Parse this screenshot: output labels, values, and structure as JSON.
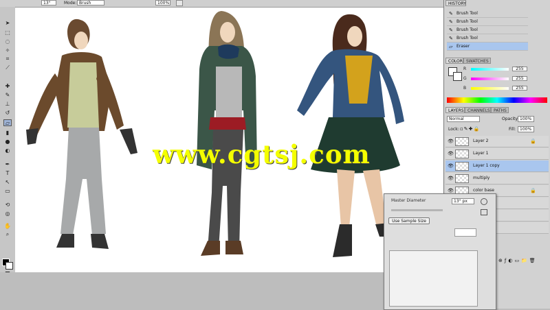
{
  "options_bar": {
    "brush_size": "13°",
    "mode_label": "Mode:",
    "mode_value": "Brush",
    "opacity_value": "100%"
  },
  "history": {
    "tab_label": "HISTORY",
    "items": [
      {
        "label": "Brush Tool",
        "icon": "brush-icon"
      },
      {
        "label": "Brush Tool",
        "icon": "brush-icon"
      },
      {
        "label": "Brush Tool",
        "icon": "brush-icon"
      },
      {
        "label": "Brush Tool",
        "icon": "brush-icon"
      },
      {
        "label": "Eraser",
        "icon": "eraser-icon"
      }
    ]
  },
  "color_panel": {
    "tabs": [
      "COLOR",
      "SWATCHES"
    ],
    "channels": [
      {
        "label": "R",
        "value": "255",
        "color": "#e02020"
      },
      {
        "label": "G",
        "value": "255",
        "color": "#20a020"
      },
      {
        "label": "B",
        "value": "255",
        "color": "#3030e0"
      }
    ]
  },
  "layers_panel": {
    "tabs": [
      "LAYERS",
      "CHANNELS",
      "PATHS"
    ],
    "blend_mode": "Normal",
    "opacity_label": "Opacity:",
    "opacity_value": "100%",
    "lock_label": "Lock:",
    "fill_label": "Fill:",
    "fill_value": "100%",
    "layers": [
      {
        "name": "Layer 2",
        "selected": false,
        "locked": true
      },
      {
        "name": "Layer 1",
        "selected": false,
        "locked": false
      },
      {
        "name": "Layer 1 copy",
        "selected": true,
        "locked": false
      },
      {
        "name": "multiply",
        "selected": false,
        "locked": false
      },
      {
        "name": "color base",
        "selected": false,
        "locked": true
      },
      {
        "name": "",
        "selected": false,
        "locked": false
      },
      {
        "name": "",
        "selected": false,
        "locked": false
      },
      {
        "name": "",
        "selected": false,
        "locked": false
      }
    ]
  },
  "dialog": {
    "title": "Master Diameter",
    "value": "13° px",
    "button_label": "Use Sample Size"
  },
  "canvas": {
    "watermark": "www.cgtsj.com"
  }
}
